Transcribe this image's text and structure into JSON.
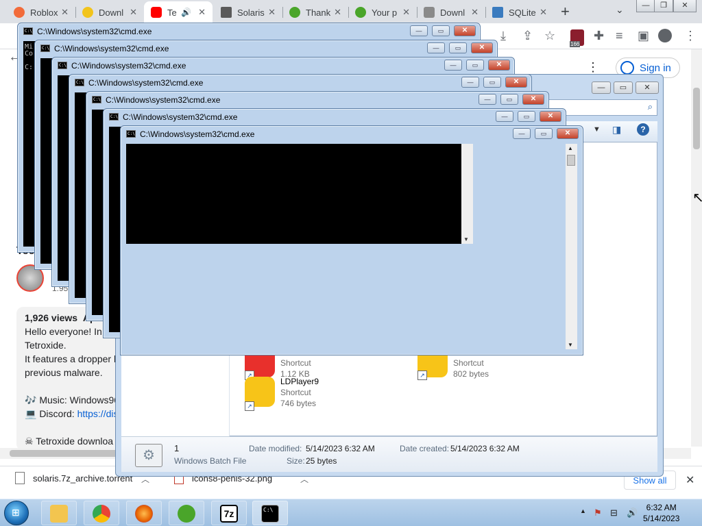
{
  "browser": {
    "tabs": [
      {
        "title": "Roblox",
        "color": "#f26b3a"
      },
      {
        "title": "Downl",
        "color": "#f2c41c"
      },
      {
        "title": "Te",
        "color": "#ff0000",
        "active": true
      },
      {
        "title": "Solaris",
        "color": "#5a5a5a"
      },
      {
        "title": "Thank",
        "color": "#4aa52a"
      },
      {
        "title": "Your p",
        "color": "#4aa52a"
      },
      {
        "title": "Downl",
        "color": "#8a8a8a"
      },
      {
        "title": "SQLite",
        "color": "#3a7bbf"
      }
    ],
    "new_tab": "+",
    "extension_badge": "166"
  },
  "youtube": {
    "sign_in": "Sign in",
    "video_title_fragment": "Tec",
    "subs_fragment": "1.95",
    "views": "1,926 views",
    "views_date_fragment": "Ap",
    "description": [
      "Hello everyone! In",
      "Tetroxide.",
      "It features a dropper l",
      "previous malware."
    ],
    "music": "🎶 Music: Windows96",
    "discord_label": "💻 Discord: ",
    "discord_link": "https://dis",
    "download": "☠ Tetroxide downloa"
  },
  "downloads": {
    "items": [
      "solaris.7z_archive.torrent",
      "icons8-penis-32.png"
    ],
    "show_all": "Show all"
  },
  "explorer": {
    "files": [
      {
        "name": "",
        "type": "Shortcut",
        "size": "1.12 KB",
        "color": "#e8302c"
      },
      {
        "name": "",
        "type": "Shortcut",
        "size": "802 bytes",
        "color": "#f7c418"
      },
      {
        "name": "LDPlayer9",
        "type": "Shortcut",
        "size": "746 bytes",
        "color": "#f7c418"
      }
    ],
    "details": {
      "name": "1",
      "type": "Windows Batch File",
      "modified_label": "Date modified:",
      "modified": "5/14/2023 6:32 AM",
      "created_label": "Date created:",
      "created": "5/14/2023 6:32 AM",
      "size_label": "Size:",
      "size": "25 bytes"
    }
  },
  "cmd": {
    "title": "C:\\Windows\\system32\\cmd.exe",
    "first_window_text": "Mi\nCo\n\nC:"
  },
  "taskbar": {
    "time": "6:32 AM",
    "date": "5/14/2023",
    "apps": [
      "explorer",
      "chrome",
      "firefox",
      "utorrent",
      "7-zip",
      "cmd"
    ],
    "sevenzip_label": "7z"
  }
}
